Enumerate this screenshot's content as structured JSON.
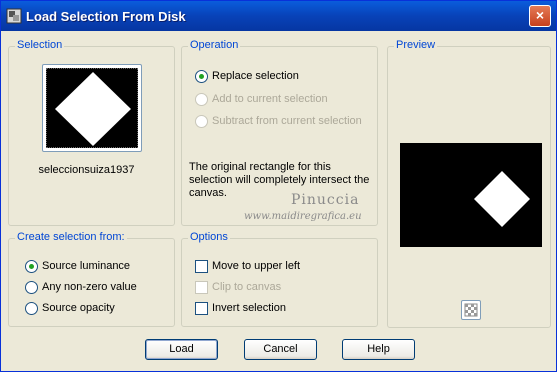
{
  "window": {
    "title": "Load Selection From Disk",
    "close_label": "×"
  },
  "selection": {
    "title": "Selection",
    "name": "seleccionsuiza1937"
  },
  "operation": {
    "title": "Operation",
    "options": [
      {
        "label": "Replace selection",
        "checked": true,
        "disabled": false
      },
      {
        "label": "Add to current selection",
        "checked": false,
        "disabled": true
      },
      {
        "label": "Subtract from current selection",
        "checked": false,
        "disabled": true
      }
    ],
    "info": "The original rectangle for this selection will completely intersect the canvas."
  },
  "watermark": {
    "line1": "Pinuccia",
    "line2": "www.maidiregrafica.eu"
  },
  "preview": {
    "title": "Preview"
  },
  "create_from": {
    "title": "Create selection from:",
    "options": [
      {
        "label": "Source luminance",
        "checked": true
      },
      {
        "label": "Any non-zero value",
        "checked": false
      },
      {
        "label": "Source opacity",
        "checked": false
      }
    ]
  },
  "options": {
    "title": "Options",
    "items": [
      {
        "label": "Move to upper left",
        "checked": false,
        "disabled": false
      },
      {
        "label": "Clip to canvas",
        "checked": false,
        "disabled": true
      },
      {
        "label": "Invert selection",
        "checked": false,
        "disabled": false
      }
    ]
  },
  "buttons": {
    "load": "Load",
    "cancel": "Cancel",
    "help": "Help"
  },
  "colors": {
    "title_bar": "#0842b8",
    "group_title": "#0046d5",
    "dialog_bg": "#ece9d8"
  }
}
